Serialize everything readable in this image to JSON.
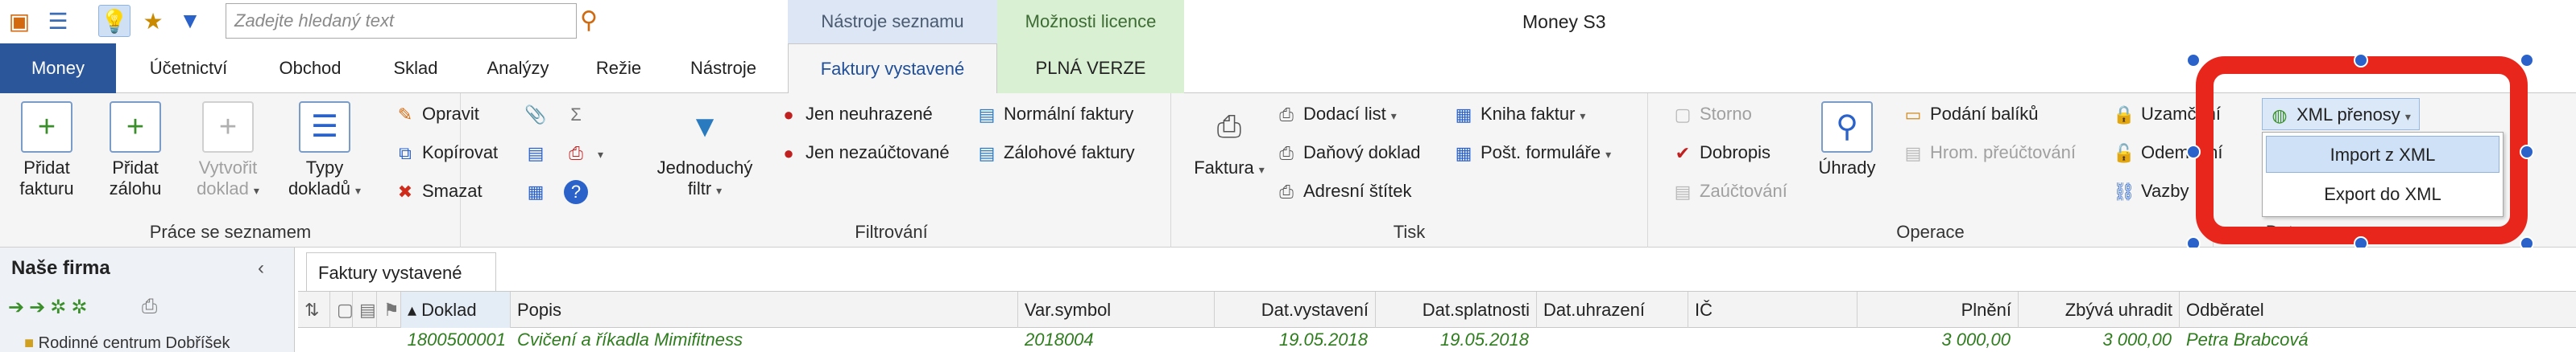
{
  "search": {
    "placeholder": "Zadejte hledaný text"
  },
  "context_headers": {
    "list_tools": "Nástroje seznamu",
    "license_options": "Možnosti licence"
  },
  "app_title": "Money S3",
  "tabs": [
    "Money",
    "Účetnictví",
    "Obchod",
    "Sklad",
    "Analýzy",
    "Režie",
    "Nástroje",
    "Faktury vystavené",
    "PLNÁ VERZE"
  ],
  "ribbon": {
    "prace": {
      "label": "Práce se seznamem",
      "pridat_fakturu": [
        "Přidat",
        "fakturu"
      ],
      "pridat_zalohu": [
        "Přidat",
        "zálohu"
      ],
      "vytvorit_doklad": [
        "Vytvořit",
        "doklad"
      ],
      "typy_dokladu": [
        "Typy",
        "dokladů"
      ],
      "opravit": "Opravit",
      "kopirovat": "Kopírovat",
      "smazat": "Smazat"
    },
    "filtrovani": {
      "label": "Filtrování",
      "jednoduchy_filtr": [
        "Jednoduchý",
        "filtr"
      ],
      "jen_neuhrazene": "Jen neuhrazené",
      "jen_nezauctovane": "Jen nezaúčtované",
      "normalni_faktury": "Normální faktury",
      "zalohove_faktury": "Zálohové faktury"
    },
    "tisk": {
      "label": "Tisk",
      "faktura": "Faktura",
      "dodaci_list": "Dodací list",
      "danovy_doklad": "Daňový doklad",
      "adresni_stitek": "Adresní štítek",
      "kniha_faktur": "Kniha faktur",
      "post_formulare": "Pošt. formuláře"
    },
    "operace": {
      "label": "Operace",
      "storno": "Storno",
      "dobropis": "Dobropis",
      "zauctovani": "Zaúčtování",
      "uhrady": "Úhrady",
      "podani_baliku": "Podání balíků",
      "hrom_preuctovani": "Hrom. přeúčtování",
      "uzamceni": "Uzamčení",
      "odemceni": "Odemčení",
      "vazby": "Vazby"
    },
    "data": {
      "label": "Data",
      "xml_prenosy": "XML přenosy",
      "import_xml": "Import z XML",
      "export_xml": "Export do XML"
    }
  },
  "left_panel": {
    "title": "Naše firma",
    "tree_item": "Rodinné centrum Dobříšek"
  },
  "doc_tab": "Faktury vystavené",
  "grid": {
    "columns": [
      "Doklad",
      "Popis",
      "Var.symbol",
      "Dat.vystavení",
      "Dat.splatnosti",
      "Dat.uhrazení",
      "IČ",
      "Plnění",
      "Zbývá uhradit",
      "Odběratel"
    ],
    "rows": [
      {
        "doklad": "1800500001",
        "popis": "Cvičení a říkadla Mimifitness",
        "varsymbol": "2018004",
        "vystaveni": "19.05.2018",
        "splatnost": "19.05.2018",
        "uhrazeni": "",
        "ic": "",
        "plneni": "3 000,00",
        "zbyva": "3 000,00",
        "odberatel": "Petra Brabcová"
      }
    ]
  },
  "colors": {
    "accent_blue": "#2b579a",
    "ctx_blue": "#dce6f4",
    "ctx_green": "#d9f0d3",
    "highlight_red": "#e8261c",
    "row_text": "#2f7d1f"
  }
}
